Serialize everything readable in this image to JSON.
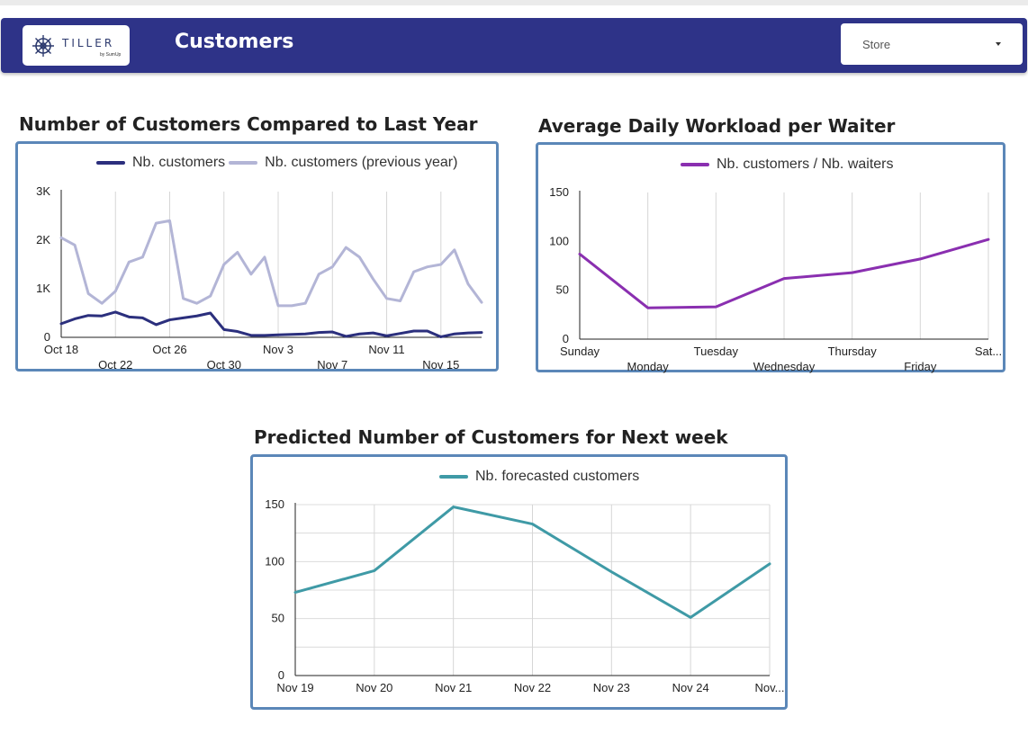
{
  "header": {
    "logo_text": "TILLER",
    "logo_sub": "by SumUp",
    "title": "Customers",
    "store_filter": {
      "label": "Store"
    }
  },
  "colors": {
    "header_bg": "#2e3388",
    "panel_border": "#5b87b8",
    "series_current": "#2b2f7d",
    "series_previous": "#b3b5d6",
    "series_workload": "#8a2fb0",
    "series_forecast": "#3f9aa6"
  },
  "chart_data": [
    {
      "type": "line",
      "title": "Number of Customers Compared to Last Year",
      "legend_position": "top",
      "grid": "vertical",
      "ylim": [
        0,
        3000
      ],
      "y_ticks": [
        0,
        1000,
        2000,
        3000
      ],
      "y_tick_labels": [
        "0",
        "1K",
        "2K",
        "3K"
      ],
      "x_tick_labels": [
        "Oct 18",
        "Oct 22",
        "Oct 26",
        "Oct 30",
        "Nov 3",
        "Nov 7",
        "Nov 11",
        "Nov 15"
      ],
      "x_tick_rows": [
        0,
        1,
        0,
        1,
        0,
        1,
        0,
        1
      ],
      "x_tick_days": [
        0,
        4,
        8,
        12,
        16,
        20,
        24,
        28
      ],
      "x_days": 32,
      "series": [
        {
          "name": "Nb. customers",
          "color": "#2b2f7d",
          "values": [
            280,
            380,
            450,
            440,
            520,
            420,
            400,
            260,
            360,
            400,
            440,
            500,
            160,
            120,
            40,
            40,
            50,
            60,
            70,
            100,
            110,
            20,
            70,
            90,
            30,
            80,
            130,
            130,
            10,
            70,
            90,
            100
          ]
        },
        {
          "name": "Nb. customers (previous year)",
          "color": "#b3b5d6",
          "values": [
            2050,
            1900,
            900,
            700,
            950,
            1550,
            1650,
            2350,
            2400,
            800,
            700,
            850,
            1500,
            1750,
            1300,
            1650,
            650,
            650,
            700,
            1300,
            1450,
            1850,
            1650,
            1200,
            800,
            750,
            1350,
            1450,
            1500,
            1800,
            1100,
            720
          ]
        }
      ]
    },
    {
      "type": "line",
      "title": "Average Daily Workload per Waiter",
      "legend_position": "top",
      "grid": "vertical",
      "ylim": [
        0,
        150
      ],
      "y_ticks": [
        0,
        50,
        100,
        150
      ],
      "y_tick_labels": [
        "0",
        "50",
        "100",
        "150"
      ],
      "categories": [
        "Sunday",
        "Monday",
        "Tuesday",
        "Wednesday",
        "Thursday",
        "Friday",
        "Sat..."
      ],
      "x_tick_rows": [
        0,
        1,
        0,
        1,
        0,
        1,
        0
      ],
      "series": [
        {
          "name": "Nb. customers / Nb. waiters",
          "color": "#8a2fb0",
          "values": [
            87,
            32,
            33,
            62,
            68,
            82,
            102
          ]
        }
      ]
    },
    {
      "type": "line",
      "title": "Predicted Number of Customers for Next week",
      "legend_position": "top",
      "grid": "both",
      "ylim": [
        0,
        150
      ],
      "y_ticks": [
        0,
        50,
        100,
        150
      ],
      "y_tick_labels": [
        "0",
        "50",
        "100",
        "150"
      ],
      "categories": [
        "Nov 19",
        "Nov 20",
        "Nov 21",
        "Nov 22",
        "Nov 23",
        "Nov 24",
        "Nov..."
      ],
      "series": [
        {
          "name": "Nb. forecasted customers",
          "color": "#3f9aa6",
          "values": [
            73,
            92,
            148,
            133,
            91,
            51,
            98
          ]
        }
      ]
    }
  ]
}
